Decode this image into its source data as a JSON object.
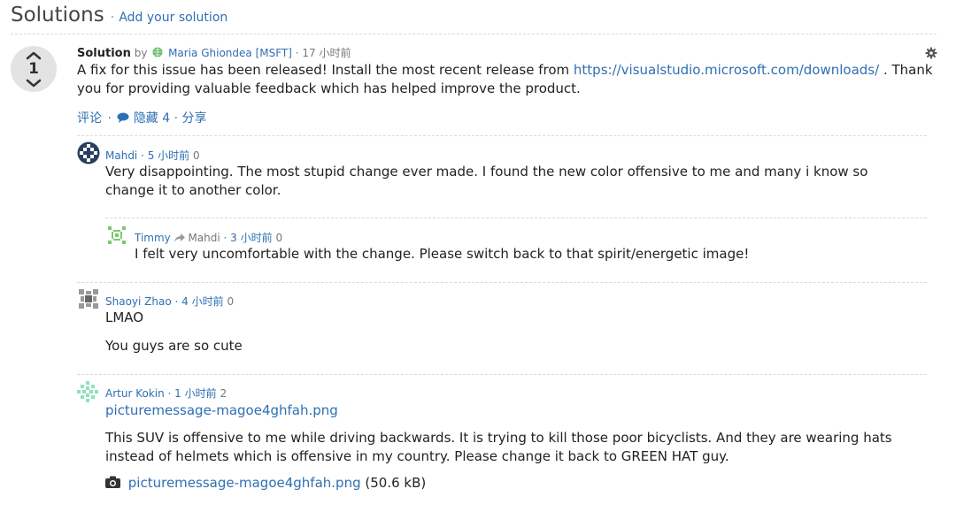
{
  "header": {
    "title": "Solutions",
    "separator": "·",
    "add_link": "Add your solution"
  },
  "solution": {
    "label": "Solution",
    "by": "by",
    "author": "Maria Ghiondea [MSFT]",
    "time": "· 17 小时前",
    "votes": "1",
    "text_before": "A fix for this issue has been released! Install the most recent release from",
    "url": "https://visualstudio.microsoft.com/downloads/",
    "text_after": ". Thank you for providing valuable feedback which has helped improve the product.",
    "actions": {
      "comment": "评论",
      "sep1": "·",
      "hide": "隐藏 4",
      "sep2": "·",
      "share": "分享"
    }
  },
  "comments": [
    {
      "author": "Mahdi",
      "time": "· 5 小时前",
      "likes": "0",
      "text": "Very disappointing. The most stupid change ever made. I found the new color offensive to me and many i know so change it to another color."
    },
    {
      "author": "Timmy",
      "reply_to": "Mahdi",
      "time": "· 3 小时前",
      "likes": "0",
      "text": "I felt very uncomfortable with the change. Please switch back to that spirit/energetic image!"
    },
    {
      "author": "Shaoyi Zhao",
      "time": "· 4 小时前",
      "likes": "0",
      "line1": "LMAO",
      "line2": "You guys are so cute"
    },
    {
      "author": "Artur Kokin",
      "time": "· 1 小时前",
      "likes": "2",
      "link": "picturemessage-magoe4ghfah.png",
      "text": "This SUV is offensive to me while driving backwards. It is trying to kill those poor bicyclists. And they are wearing hats instead of helmets which is offensive in my country. Please change it back to GREEN HAT guy.",
      "attachment": {
        "name": "picturemessage-magoe4ghfah.png",
        "size": "(50.6 kB)"
      }
    }
  ],
  "icons": {
    "vote_up": "chevron-up-icon",
    "vote_down": "chevron-down-icon",
    "settings": "gear-icon",
    "comments": "speech-bubble-icon",
    "reply": "reply-arrow-icon",
    "camera": "camera-icon"
  },
  "colors": {
    "link": "#2f6fb3",
    "vote_bg": "#e3e3e3"
  }
}
